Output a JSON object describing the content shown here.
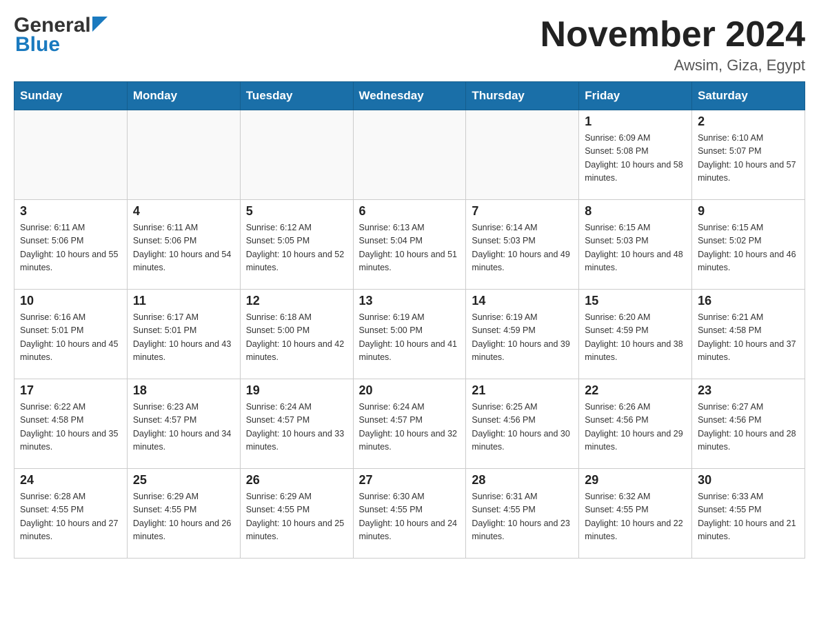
{
  "header": {
    "logo_general": "General",
    "logo_blue": "Blue",
    "month_title": "November 2024",
    "location": "Awsim, Giza, Egypt"
  },
  "weekdays": [
    "Sunday",
    "Monday",
    "Tuesday",
    "Wednesday",
    "Thursday",
    "Friday",
    "Saturday"
  ],
  "weeks": [
    [
      {
        "day": "",
        "sunrise": "",
        "sunset": "",
        "daylight": ""
      },
      {
        "day": "",
        "sunrise": "",
        "sunset": "",
        "daylight": ""
      },
      {
        "day": "",
        "sunrise": "",
        "sunset": "",
        "daylight": ""
      },
      {
        "day": "",
        "sunrise": "",
        "sunset": "",
        "daylight": ""
      },
      {
        "day": "",
        "sunrise": "",
        "sunset": "",
        "daylight": ""
      },
      {
        "day": "1",
        "sunrise": "Sunrise: 6:09 AM",
        "sunset": "Sunset: 5:08 PM",
        "daylight": "Daylight: 10 hours and 58 minutes."
      },
      {
        "day": "2",
        "sunrise": "Sunrise: 6:10 AM",
        "sunset": "Sunset: 5:07 PM",
        "daylight": "Daylight: 10 hours and 57 minutes."
      }
    ],
    [
      {
        "day": "3",
        "sunrise": "Sunrise: 6:11 AM",
        "sunset": "Sunset: 5:06 PM",
        "daylight": "Daylight: 10 hours and 55 minutes."
      },
      {
        "day": "4",
        "sunrise": "Sunrise: 6:11 AM",
        "sunset": "Sunset: 5:06 PM",
        "daylight": "Daylight: 10 hours and 54 minutes."
      },
      {
        "day": "5",
        "sunrise": "Sunrise: 6:12 AM",
        "sunset": "Sunset: 5:05 PM",
        "daylight": "Daylight: 10 hours and 52 minutes."
      },
      {
        "day": "6",
        "sunrise": "Sunrise: 6:13 AM",
        "sunset": "Sunset: 5:04 PM",
        "daylight": "Daylight: 10 hours and 51 minutes."
      },
      {
        "day": "7",
        "sunrise": "Sunrise: 6:14 AM",
        "sunset": "Sunset: 5:03 PM",
        "daylight": "Daylight: 10 hours and 49 minutes."
      },
      {
        "day": "8",
        "sunrise": "Sunrise: 6:15 AM",
        "sunset": "Sunset: 5:03 PM",
        "daylight": "Daylight: 10 hours and 48 minutes."
      },
      {
        "day": "9",
        "sunrise": "Sunrise: 6:15 AM",
        "sunset": "Sunset: 5:02 PM",
        "daylight": "Daylight: 10 hours and 46 minutes."
      }
    ],
    [
      {
        "day": "10",
        "sunrise": "Sunrise: 6:16 AM",
        "sunset": "Sunset: 5:01 PM",
        "daylight": "Daylight: 10 hours and 45 minutes."
      },
      {
        "day": "11",
        "sunrise": "Sunrise: 6:17 AM",
        "sunset": "Sunset: 5:01 PM",
        "daylight": "Daylight: 10 hours and 43 minutes."
      },
      {
        "day": "12",
        "sunrise": "Sunrise: 6:18 AM",
        "sunset": "Sunset: 5:00 PM",
        "daylight": "Daylight: 10 hours and 42 minutes."
      },
      {
        "day": "13",
        "sunrise": "Sunrise: 6:19 AM",
        "sunset": "Sunset: 5:00 PM",
        "daylight": "Daylight: 10 hours and 41 minutes."
      },
      {
        "day": "14",
        "sunrise": "Sunrise: 6:19 AM",
        "sunset": "Sunset: 4:59 PM",
        "daylight": "Daylight: 10 hours and 39 minutes."
      },
      {
        "day": "15",
        "sunrise": "Sunrise: 6:20 AM",
        "sunset": "Sunset: 4:59 PM",
        "daylight": "Daylight: 10 hours and 38 minutes."
      },
      {
        "day": "16",
        "sunrise": "Sunrise: 6:21 AM",
        "sunset": "Sunset: 4:58 PM",
        "daylight": "Daylight: 10 hours and 37 minutes."
      }
    ],
    [
      {
        "day": "17",
        "sunrise": "Sunrise: 6:22 AM",
        "sunset": "Sunset: 4:58 PM",
        "daylight": "Daylight: 10 hours and 35 minutes."
      },
      {
        "day": "18",
        "sunrise": "Sunrise: 6:23 AM",
        "sunset": "Sunset: 4:57 PM",
        "daylight": "Daylight: 10 hours and 34 minutes."
      },
      {
        "day": "19",
        "sunrise": "Sunrise: 6:24 AM",
        "sunset": "Sunset: 4:57 PM",
        "daylight": "Daylight: 10 hours and 33 minutes."
      },
      {
        "day": "20",
        "sunrise": "Sunrise: 6:24 AM",
        "sunset": "Sunset: 4:57 PM",
        "daylight": "Daylight: 10 hours and 32 minutes."
      },
      {
        "day": "21",
        "sunrise": "Sunrise: 6:25 AM",
        "sunset": "Sunset: 4:56 PM",
        "daylight": "Daylight: 10 hours and 30 minutes."
      },
      {
        "day": "22",
        "sunrise": "Sunrise: 6:26 AM",
        "sunset": "Sunset: 4:56 PM",
        "daylight": "Daylight: 10 hours and 29 minutes."
      },
      {
        "day": "23",
        "sunrise": "Sunrise: 6:27 AM",
        "sunset": "Sunset: 4:56 PM",
        "daylight": "Daylight: 10 hours and 28 minutes."
      }
    ],
    [
      {
        "day": "24",
        "sunrise": "Sunrise: 6:28 AM",
        "sunset": "Sunset: 4:55 PM",
        "daylight": "Daylight: 10 hours and 27 minutes."
      },
      {
        "day": "25",
        "sunrise": "Sunrise: 6:29 AM",
        "sunset": "Sunset: 4:55 PM",
        "daylight": "Daylight: 10 hours and 26 minutes."
      },
      {
        "day": "26",
        "sunrise": "Sunrise: 6:29 AM",
        "sunset": "Sunset: 4:55 PM",
        "daylight": "Daylight: 10 hours and 25 minutes."
      },
      {
        "day": "27",
        "sunrise": "Sunrise: 6:30 AM",
        "sunset": "Sunset: 4:55 PM",
        "daylight": "Daylight: 10 hours and 24 minutes."
      },
      {
        "day": "28",
        "sunrise": "Sunrise: 6:31 AM",
        "sunset": "Sunset: 4:55 PM",
        "daylight": "Daylight: 10 hours and 23 minutes."
      },
      {
        "day": "29",
        "sunrise": "Sunrise: 6:32 AM",
        "sunset": "Sunset: 4:55 PM",
        "daylight": "Daylight: 10 hours and 22 minutes."
      },
      {
        "day": "30",
        "sunrise": "Sunrise: 6:33 AM",
        "sunset": "Sunset: 4:55 PM",
        "daylight": "Daylight: 10 hours and 21 minutes."
      }
    ]
  ]
}
